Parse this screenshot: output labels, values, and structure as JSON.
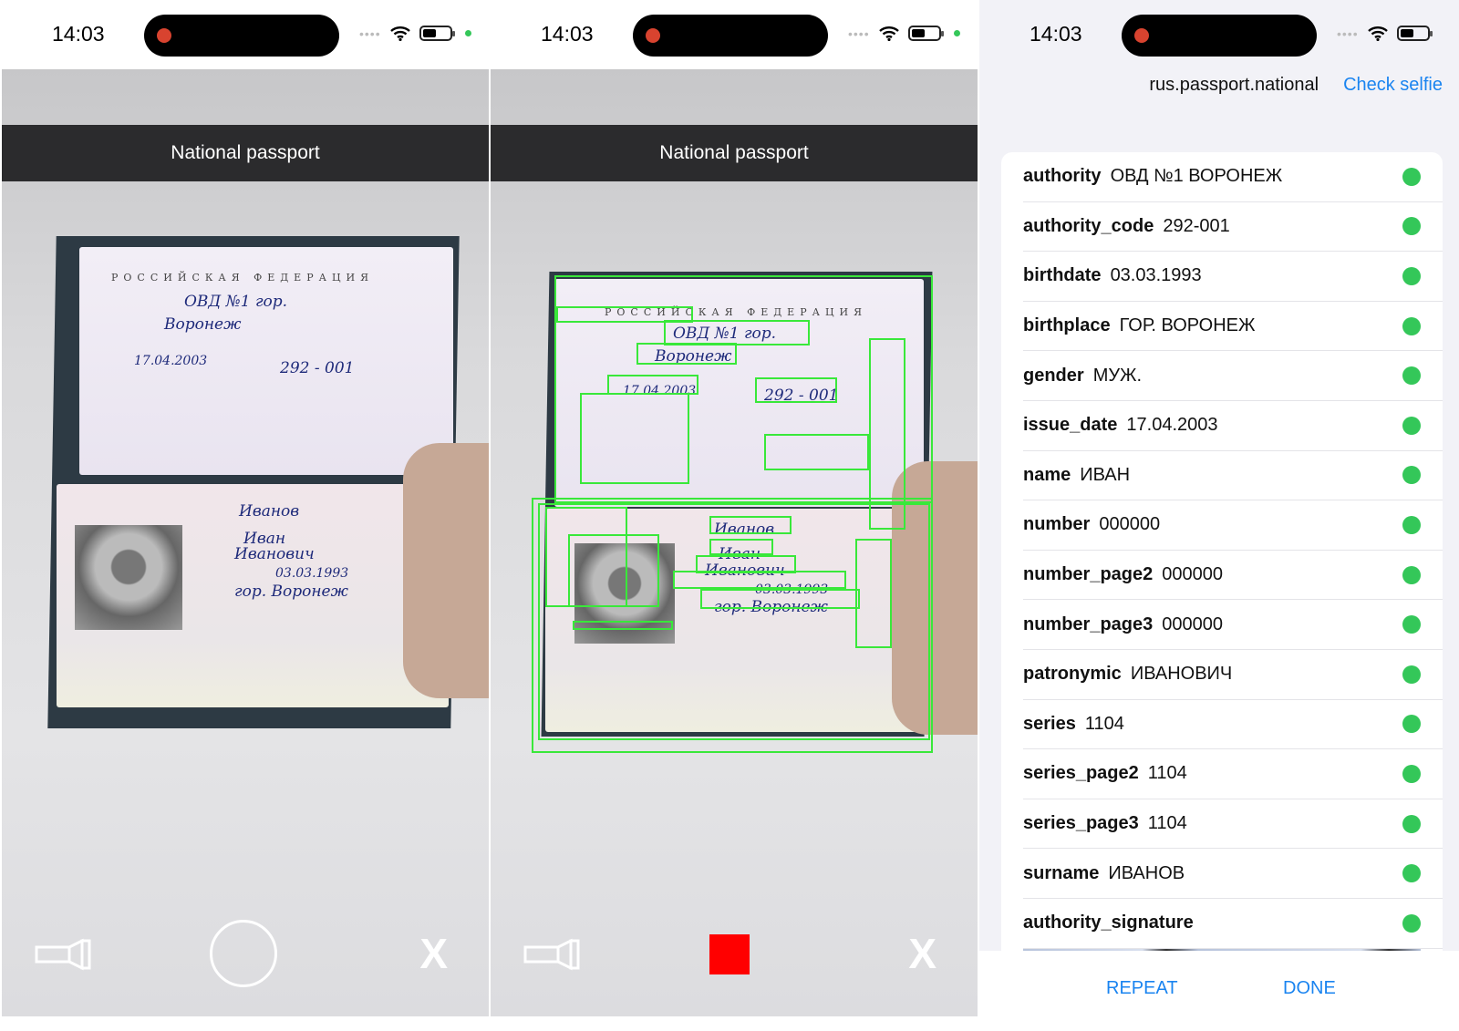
{
  "scanner_left": {
    "time": "14:03",
    "header": "National passport",
    "close_label": "X",
    "shutter_state": "idle"
  },
  "scanner_middle": {
    "time": "14:03",
    "header": "National passport",
    "close_label": "X",
    "shutter_state": "recording"
  },
  "passport_text": {
    "issued_by": "ОВД №1 гор.",
    "city": "Воронеж",
    "issue_date": "17.04.2003",
    "code": "292 - 001",
    "surname": "Иванов",
    "name": "Иван",
    "patronymic": "Иванович",
    "birthdate": "03.03.1993",
    "birthplace": "гор. Воронеж",
    "country": "РОССИЙСКАЯ ФЕДЕРАЦИЯ"
  },
  "results": {
    "time": "14:03",
    "document_type": "rus.passport.national",
    "check_selfie_label": "Check selfie",
    "fields": [
      {
        "key": "authority",
        "value": "ОВД №1 ВОРОНЕЖ"
      },
      {
        "key": "authority_code",
        "value": "292-001"
      },
      {
        "key": "birthdate",
        "value": "03.03.1993"
      },
      {
        "key": "birthplace",
        "value": "ГОР. ВОРОНЕЖ"
      },
      {
        "key": "gender",
        "value": "МУЖ."
      },
      {
        "key": "issue_date",
        "value": "17.04.2003"
      },
      {
        "key": "name",
        "value": "ИВАН"
      },
      {
        "key": "number",
        "value": "000000"
      },
      {
        "key": "number_page2",
        "value": "000000"
      },
      {
        "key": "number_page3",
        "value": "000000"
      },
      {
        "key": "patronymic",
        "value": "ИВАНОВИЧ"
      },
      {
        "key": "series",
        "value": "1104"
      },
      {
        "key": "series_page2",
        "value": "1104"
      },
      {
        "key": "series_page3",
        "value": "1104"
      },
      {
        "key": "surname",
        "value": "ИВАНОВ"
      },
      {
        "key": "authority_signature",
        "value": ""
      }
    ],
    "status_color": "#34c759",
    "repeat_label": "REPEAT",
    "done_label": "DONE"
  },
  "colors": {
    "accent": "#1a84f0",
    "detection_box": "#39e83a",
    "record": "#ff0000"
  },
  "icons": {
    "torch": "flashlight-icon",
    "wifi": "wifi-icon",
    "battery": "battery-icon"
  }
}
